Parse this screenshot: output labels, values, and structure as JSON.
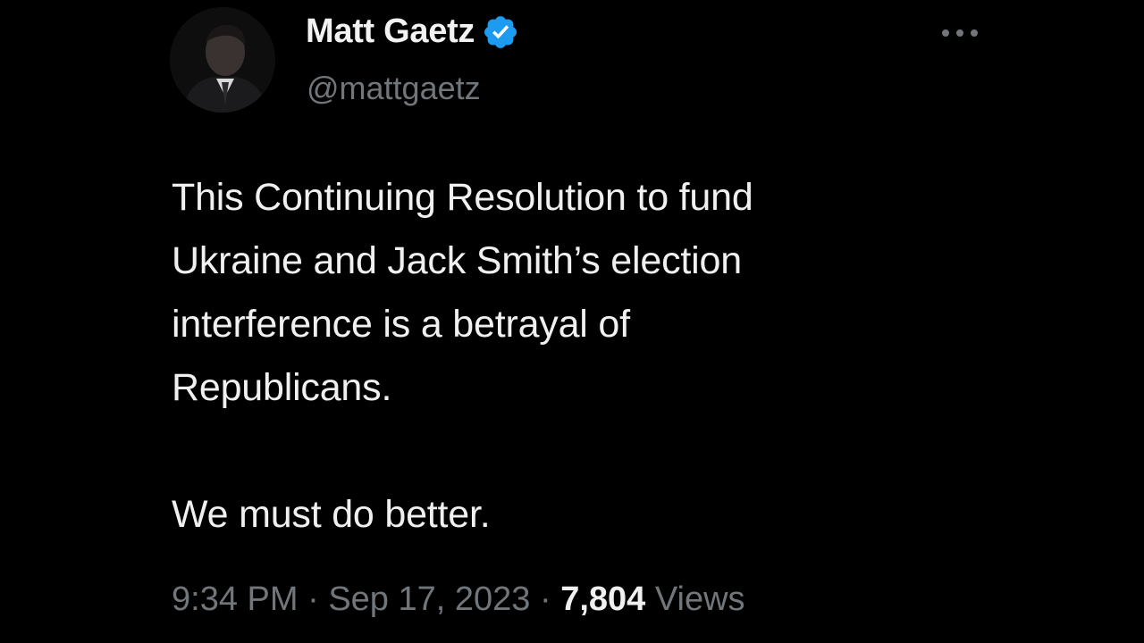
{
  "tweet": {
    "display_name": "Matt Gaetz",
    "handle": "@mattgaetz",
    "verified_icon": "verified-badge-icon",
    "more_icon": "more-horizontal-icon",
    "text_lines": {
      "line1": "This Continuing Resolution to fund",
      "line2": "Ukraine and Jack Smith’s election",
      "line3": "interference is a betrayal of",
      "line4": "Republicans.",
      "line5": "We must do better."
    },
    "time": "9:34 PM",
    "separator": "·",
    "date": "Sep 17, 2023",
    "views_count": "7,804",
    "views_label": "Views"
  },
  "colors": {
    "background": "#000000",
    "text": "#e7e9ea",
    "muted": "#71767b",
    "verified": "#1d9bf0"
  }
}
